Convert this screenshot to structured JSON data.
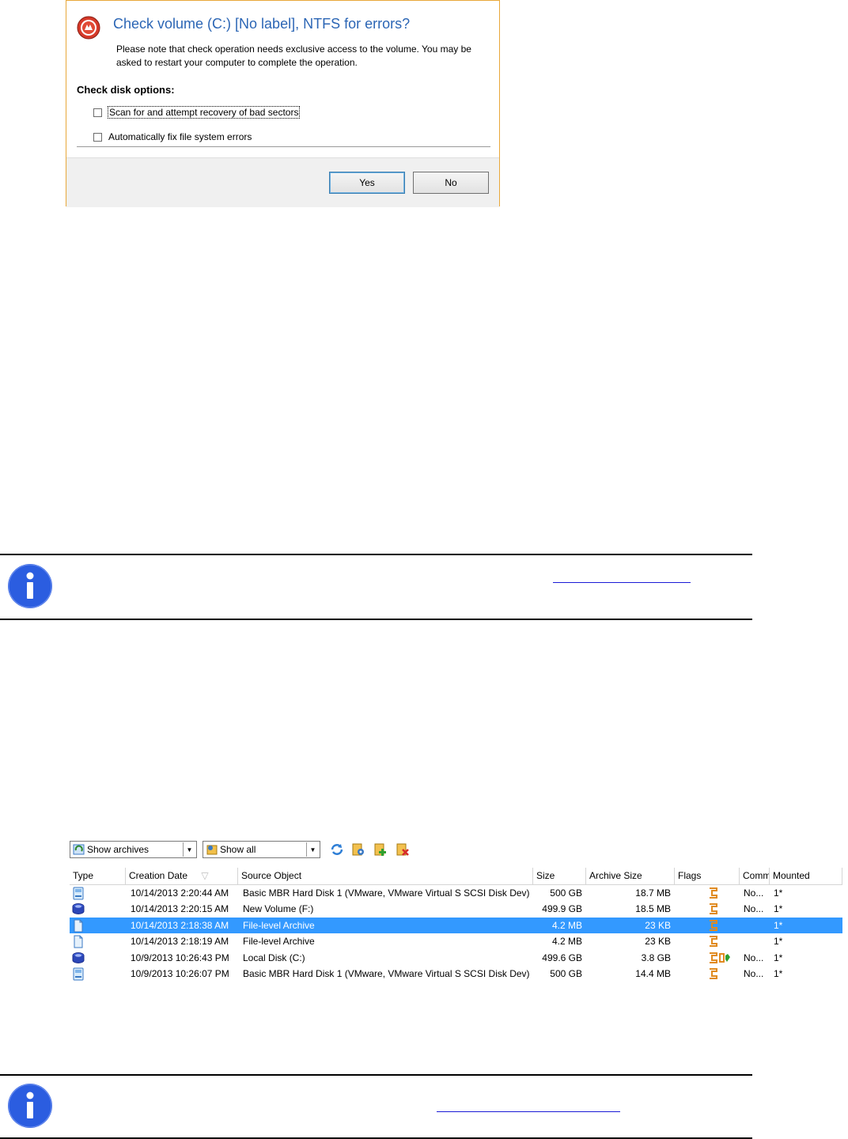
{
  "dialog": {
    "title": "Check volume (C:) [No label], NTFS for errors?",
    "note": "Please note that check operation needs exclusive access to the volume. You may be asked to restart your computer to complete the operation.",
    "options_heading": "Check disk options:",
    "options": [
      {
        "label": "Scan for and attempt recovery of bad sectors",
        "checked": false
      },
      {
        "label": "Automatically fix file system errors",
        "checked": false
      }
    ],
    "yes_label": "Yes",
    "no_label": "No",
    "title_color": "#2c66b5",
    "border_color": "#e8a83a"
  },
  "archives": {
    "filter_combo": "Show archives",
    "show_combo": "Show all",
    "toolbar_icons": [
      "refresh-icon",
      "archive-properties-icon",
      "add-archive-icon",
      "delete-archive-icon"
    ],
    "columns": [
      "Type",
      "Creation Date",
      "Source Object",
      "Size",
      "Archive Size",
      "Flags",
      "Comm",
      "Mounted"
    ],
    "rows": [
      {
        "type": "disk",
        "date": "10/14/2013 2:20:44 AM",
        "source": "Basic MBR Hard Disk 1 (VMware, VMware Virtual S SCSI Disk Dev)",
        "size": "500 GB",
        "archive_size": "18.7 MB",
        "comm": "No...",
        "mounted": "1*",
        "selected": false
      },
      {
        "type": "volume",
        "date": "10/14/2013 2:20:15 AM",
        "source": "New Volume (F:)",
        "size": "499.9 GB",
        "archive_size": "18.5 MB",
        "comm": "No...",
        "mounted": "1*",
        "selected": false
      },
      {
        "type": "file",
        "date": "10/14/2013 2:18:38 AM",
        "source": "File-level Archive",
        "size": "4.2 MB",
        "archive_size": "23 KB",
        "comm": "",
        "mounted": "1*",
        "selected": true
      },
      {
        "type": "file",
        "date": "10/14/2013 2:18:19 AM",
        "source": "File-level Archive",
        "size": "4.2 MB",
        "archive_size": "23 KB",
        "comm": "",
        "mounted": "1*",
        "selected": false
      },
      {
        "type": "volume",
        "date": "10/9/2013 10:26:43 PM",
        "source": "Local Disk (C:)",
        "size": "499.6 GB",
        "archive_size": "3.8 GB",
        "comm": "No...",
        "mounted": "1*",
        "selected": false
      },
      {
        "type": "disk",
        "date": "10/9/2013 10:26:07 PM",
        "source": "Basic MBR Hard Disk 1 (VMware, VMware Virtual S SCSI Disk Dev)",
        "size": "500 GB",
        "archive_size": "14.4 MB",
        "comm": "No...",
        "mounted": "1*",
        "selected": false
      }
    ],
    "selection_color": "#3399ff"
  },
  "info_icon_color": "#2b5de0"
}
